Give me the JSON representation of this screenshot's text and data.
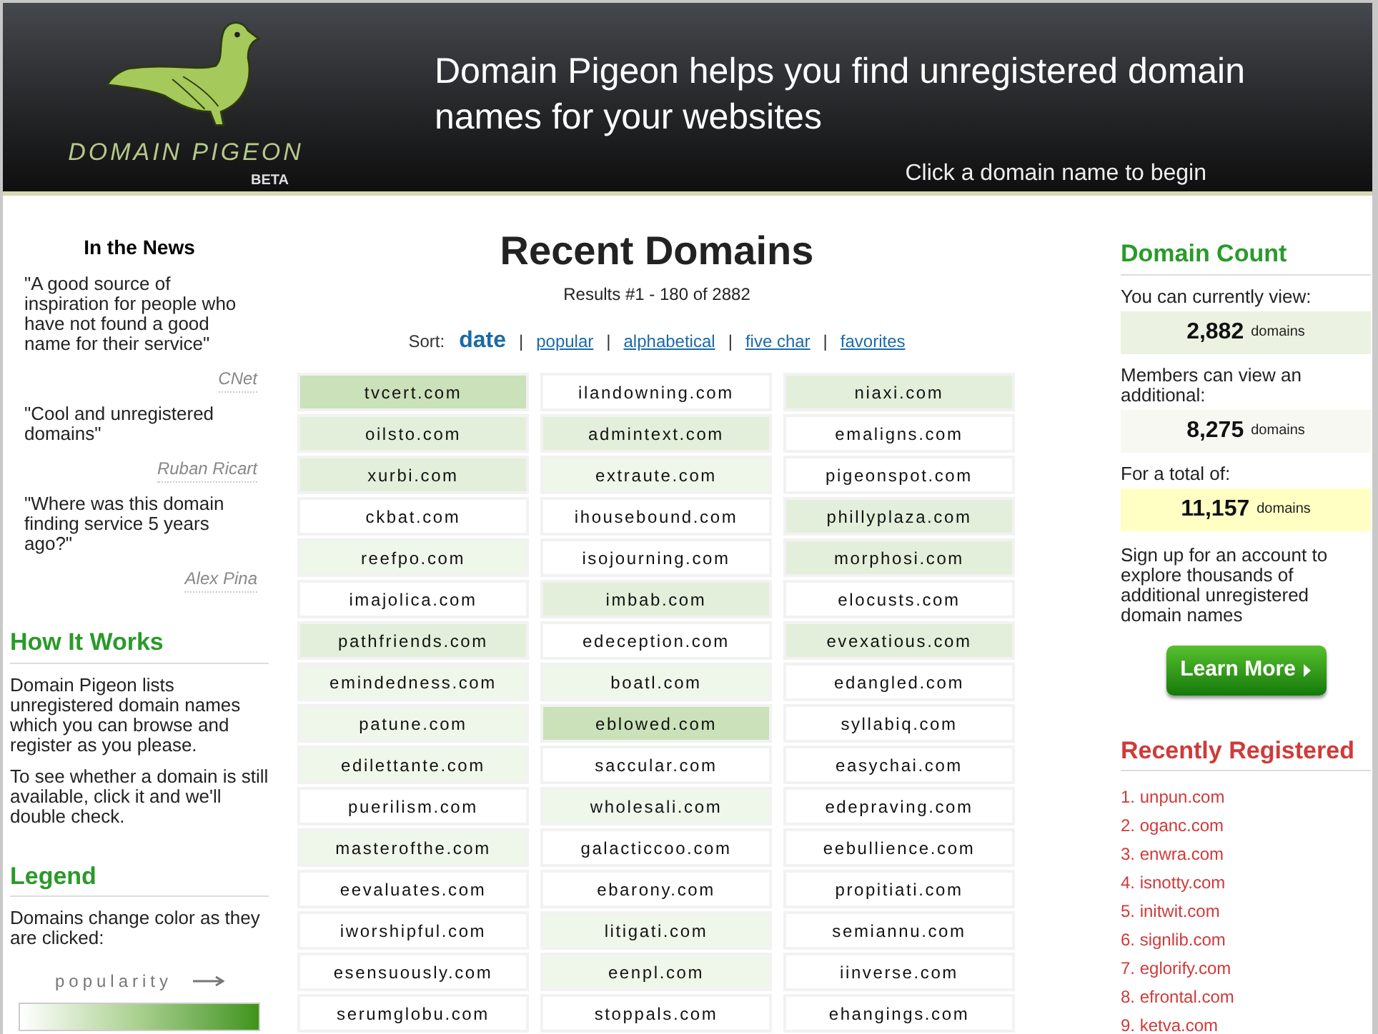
{
  "header": {
    "logo_text": "DOMAIN PIGEON",
    "logo_badge": "BETA",
    "tagline": "Domain Pigeon helps you find unregistered domain names for your websites",
    "hint": "Click a domain name to begin"
  },
  "news": {
    "title": "In the News",
    "quotes": [
      {
        "text": "\"A good source of inspiration for people who have not found a good name for their service\"",
        "source": "CNet"
      },
      {
        "text": "\"Cool and unregistered domains\"",
        "source": "Ruban Ricart"
      },
      {
        "text": "\"Where was this domain finding service 5 years ago?\"",
        "source": "Alex Pina"
      }
    ]
  },
  "how_it_works": {
    "title": "How It Works",
    "paragraphs": [
      "Domain Pigeon lists unregistered domain names which you can browse and register as you please.",
      "To see whether a domain is still available, click it and we'll double check."
    ]
  },
  "legend": {
    "title": "Legend",
    "text": "Domains change color as they are clicked:",
    "scale_label": "popularity"
  },
  "main": {
    "title": "Recent Domains",
    "results": "Results #1 - 180 of 2882",
    "sort_label": "Sort:",
    "sort_separator": "|",
    "sort_options": [
      {
        "label": "date",
        "selected": true
      },
      {
        "label": "popular",
        "selected": false
      },
      {
        "label": "alphabetical",
        "selected": false
      },
      {
        "label": "five char",
        "selected": false
      },
      {
        "label": "favorites",
        "selected": false
      }
    ],
    "domains": [
      {
        "name": "tvcert.com",
        "color": "#cbe1b9"
      },
      {
        "name": "ilandowning.com",
        "color": "#ffffff"
      },
      {
        "name": "niaxi.com",
        "color": "#e3efdb"
      },
      {
        "name": "oilsto.com",
        "color": "#e3efdb"
      },
      {
        "name": "admintext.com",
        "color": "#e3efdb"
      },
      {
        "name": "emaligns.com",
        "color": "#ffffff"
      },
      {
        "name": "xurbi.com",
        "color": "#e3efdb"
      },
      {
        "name": "extraute.com",
        "color": "#eff6ea"
      },
      {
        "name": "pigeonspot.com",
        "color": "#ffffff"
      },
      {
        "name": "ckbat.com",
        "color": "#ffffff"
      },
      {
        "name": "ihousebound.com",
        "color": "#ffffff"
      },
      {
        "name": "phillyplaza.com",
        "color": "#e3efdb"
      },
      {
        "name": "reefpo.com",
        "color": "#eff6ea"
      },
      {
        "name": "isojourning.com",
        "color": "#ffffff"
      },
      {
        "name": "morphosi.com",
        "color": "#e3efdb"
      },
      {
        "name": "imajolica.com",
        "color": "#ffffff"
      },
      {
        "name": "imbab.com",
        "color": "#e3efdb"
      },
      {
        "name": "elocusts.com",
        "color": "#ffffff"
      },
      {
        "name": "pathfriends.com",
        "color": "#e3efdb"
      },
      {
        "name": "edeception.com",
        "color": "#ffffff"
      },
      {
        "name": "evexatious.com",
        "color": "#e3efdb"
      },
      {
        "name": "emindedness.com",
        "color": "#eff6ea"
      },
      {
        "name": "boatl.com",
        "color": "#eff6ea"
      },
      {
        "name": "edangled.com",
        "color": "#ffffff"
      },
      {
        "name": "patune.com",
        "color": "#eff6ea"
      },
      {
        "name": "eblowed.com",
        "color": "#cbe1b9"
      },
      {
        "name": "syllabiq.com",
        "color": "#ffffff"
      },
      {
        "name": "edilettante.com",
        "color": "#eff6ea"
      },
      {
        "name": "saccular.com",
        "color": "#ffffff"
      },
      {
        "name": "easychai.com",
        "color": "#ffffff"
      },
      {
        "name": "puerilism.com",
        "color": "#ffffff"
      },
      {
        "name": "wholesali.com",
        "color": "#eff6ea"
      },
      {
        "name": "edepraving.com",
        "color": "#ffffff"
      },
      {
        "name": "masterofthe.com",
        "color": "#eff6ea"
      },
      {
        "name": "galacticcoo.com",
        "color": "#ffffff"
      },
      {
        "name": "eebullience.com",
        "color": "#ffffff"
      },
      {
        "name": "eevaluates.com",
        "color": "#ffffff"
      },
      {
        "name": "ebarony.com",
        "color": "#ffffff"
      },
      {
        "name": "propitiati.com",
        "color": "#ffffff"
      },
      {
        "name": "iworshipful.com",
        "color": "#ffffff"
      },
      {
        "name": "litigati.com",
        "color": "#eff6ea"
      },
      {
        "name": "semiannu.com",
        "color": "#ffffff"
      },
      {
        "name": "esensuously.com",
        "color": "#ffffff"
      },
      {
        "name": "eenpl.com",
        "color": "#eff6ea"
      },
      {
        "name": "iinverse.com",
        "color": "#ffffff"
      },
      {
        "name": "serumglobu.com",
        "color": "#ffffff"
      },
      {
        "name": "stoppals.com",
        "color": "#ffffff"
      },
      {
        "name": "ehangings.com",
        "color": "#ffffff"
      }
    ]
  },
  "domain_count": {
    "title": "Domain Count",
    "counts": [
      {
        "label": "You can currently view:",
        "value": "2,882",
        "unit": "domains",
        "color": "#ebf2e1"
      },
      {
        "label": "Members can view an additional:",
        "value": "8,275",
        "unit": "domains",
        "color": "#f8f8f3"
      },
      {
        "label": "For a total of:",
        "value": "11,157",
        "unit": "domains",
        "color": "#ffffc4"
      }
    ],
    "signup_text": "Sign up for an account to explore thousands of additional unregistered domain names",
    "button": "Learn More"
  },
  "recently_registered": {
    "title": "Recently Registered",
    "items": [
      "1. unpun.com",
      "2. oganc.com",
      "3. enwra.com",
      "4. isnotty.com",
      "5. initwit.com",
      "6. signlib.com",
      "7. eglorify.com",
      "8. efrontal.com",
      "9. ketva.com"
    ]
  }
}
